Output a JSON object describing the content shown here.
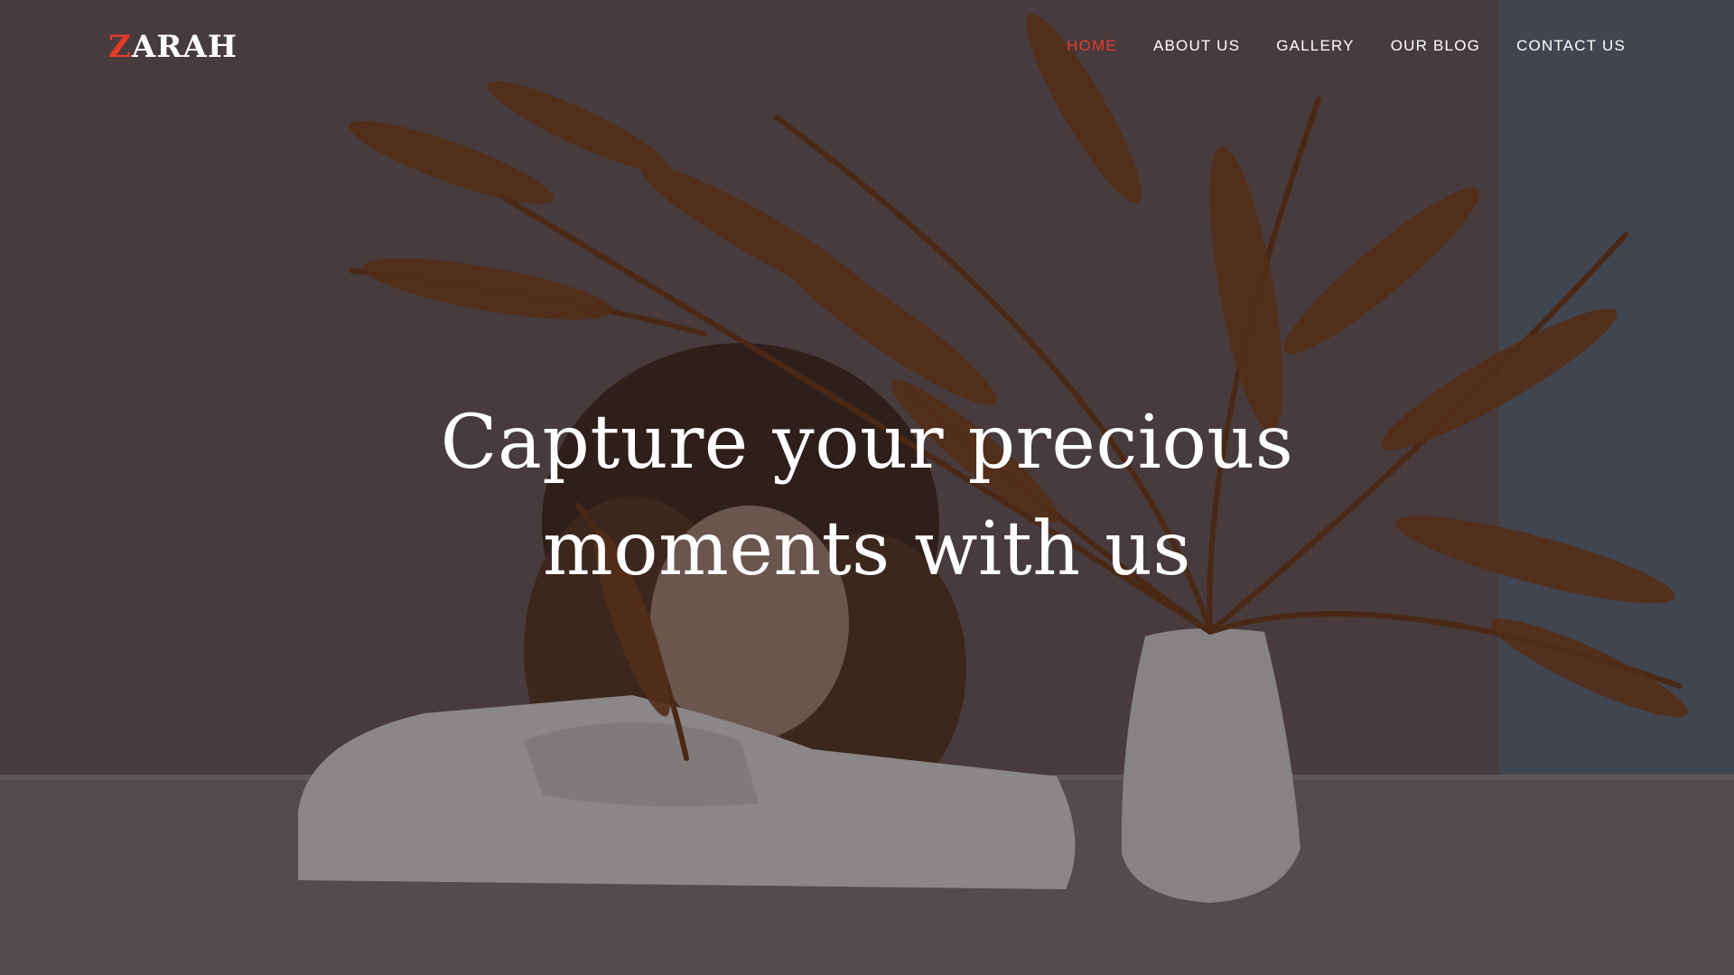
{
  "brand": {
    "logo_first_letter": "Z",
    "logo_rest": "ARAH",
    "accent_color": "#e53a2a"
  },
  "nav": {
    "items": [
      {
        "label": "HOME",
        "active": true
      },
      {
        "label": "ABOUT US",
        "active": false
      },
      {
        "label": "GALLERY",
        "active": false
      },
      {
        "label": "OUR BLOG",
        "active": false
      },
      {
        "label": "CONTACT US",
        "active": false
      }
    ]
  },
  "hero": {
    "headline_line1": "Capture your precious",
    "headline_line2": "moments with us",
    "background_image": "woman-resting-on-table-with-dried-fern-vase"
  }
}
